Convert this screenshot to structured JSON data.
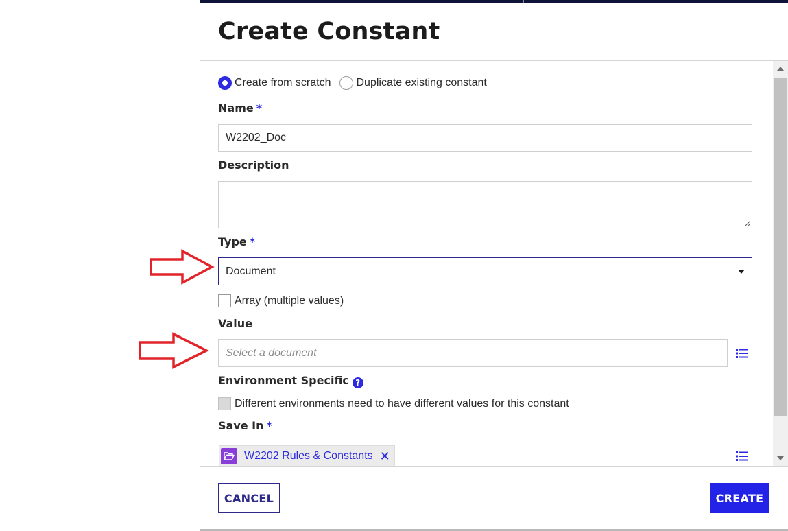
{
  "dialog": {
    "title": "Create Constant"
  },
  "mode": {
    "options": [
      {
        "label": "Create from scratch",
        "selected": true
      },
      {
        "label": "Duplicate existing constant",
        "selected": false
      }
    ]
  },
  "form": {
    "name": {
      "label": "Name",
      "required_mark": "*",
      "value": "W2202_Doc"
    },
    "description": {
      "label": "Description",
      "value": ""
    },
    "type": {
      "label": "Type",
      "required_mark": "*",
      "selected": "Document"
    },
    "array": {
      "label": "Array (multiple values)",
      "checked": false
    },
    "value": {
      "label": "Value",
      "placeholder": "Select a document"
    },
    "environment": {
      "label": "Environment Specific",
      "help_icon": "question-circle-icon",
      "help_glyph": "?",
      "checkbox_label": "Different environments need to have different values for this constant",
      "checked": false,
      "disabled": true
    },
    "save_in": {
      "label": "Save In",
      "required_mark": "*",
      "chip_label": "W2202 Rules & Constants",
      "chip_icon": "folder-open-icon",
      "remove_glyph": "✕"
    }
  },
  "footer": {
    "cancel_label": "CANCEL",
    "create_label": "CREATE"
  },
  "colors": {
    "accent": "#2d2ae0",
    "primary_button": "#2323e8",
    "folder_chip": "#8a3ed8",
    "annotation_arrow": "#e0242a",
    "header_bar": "#0e1438"
  }
}
